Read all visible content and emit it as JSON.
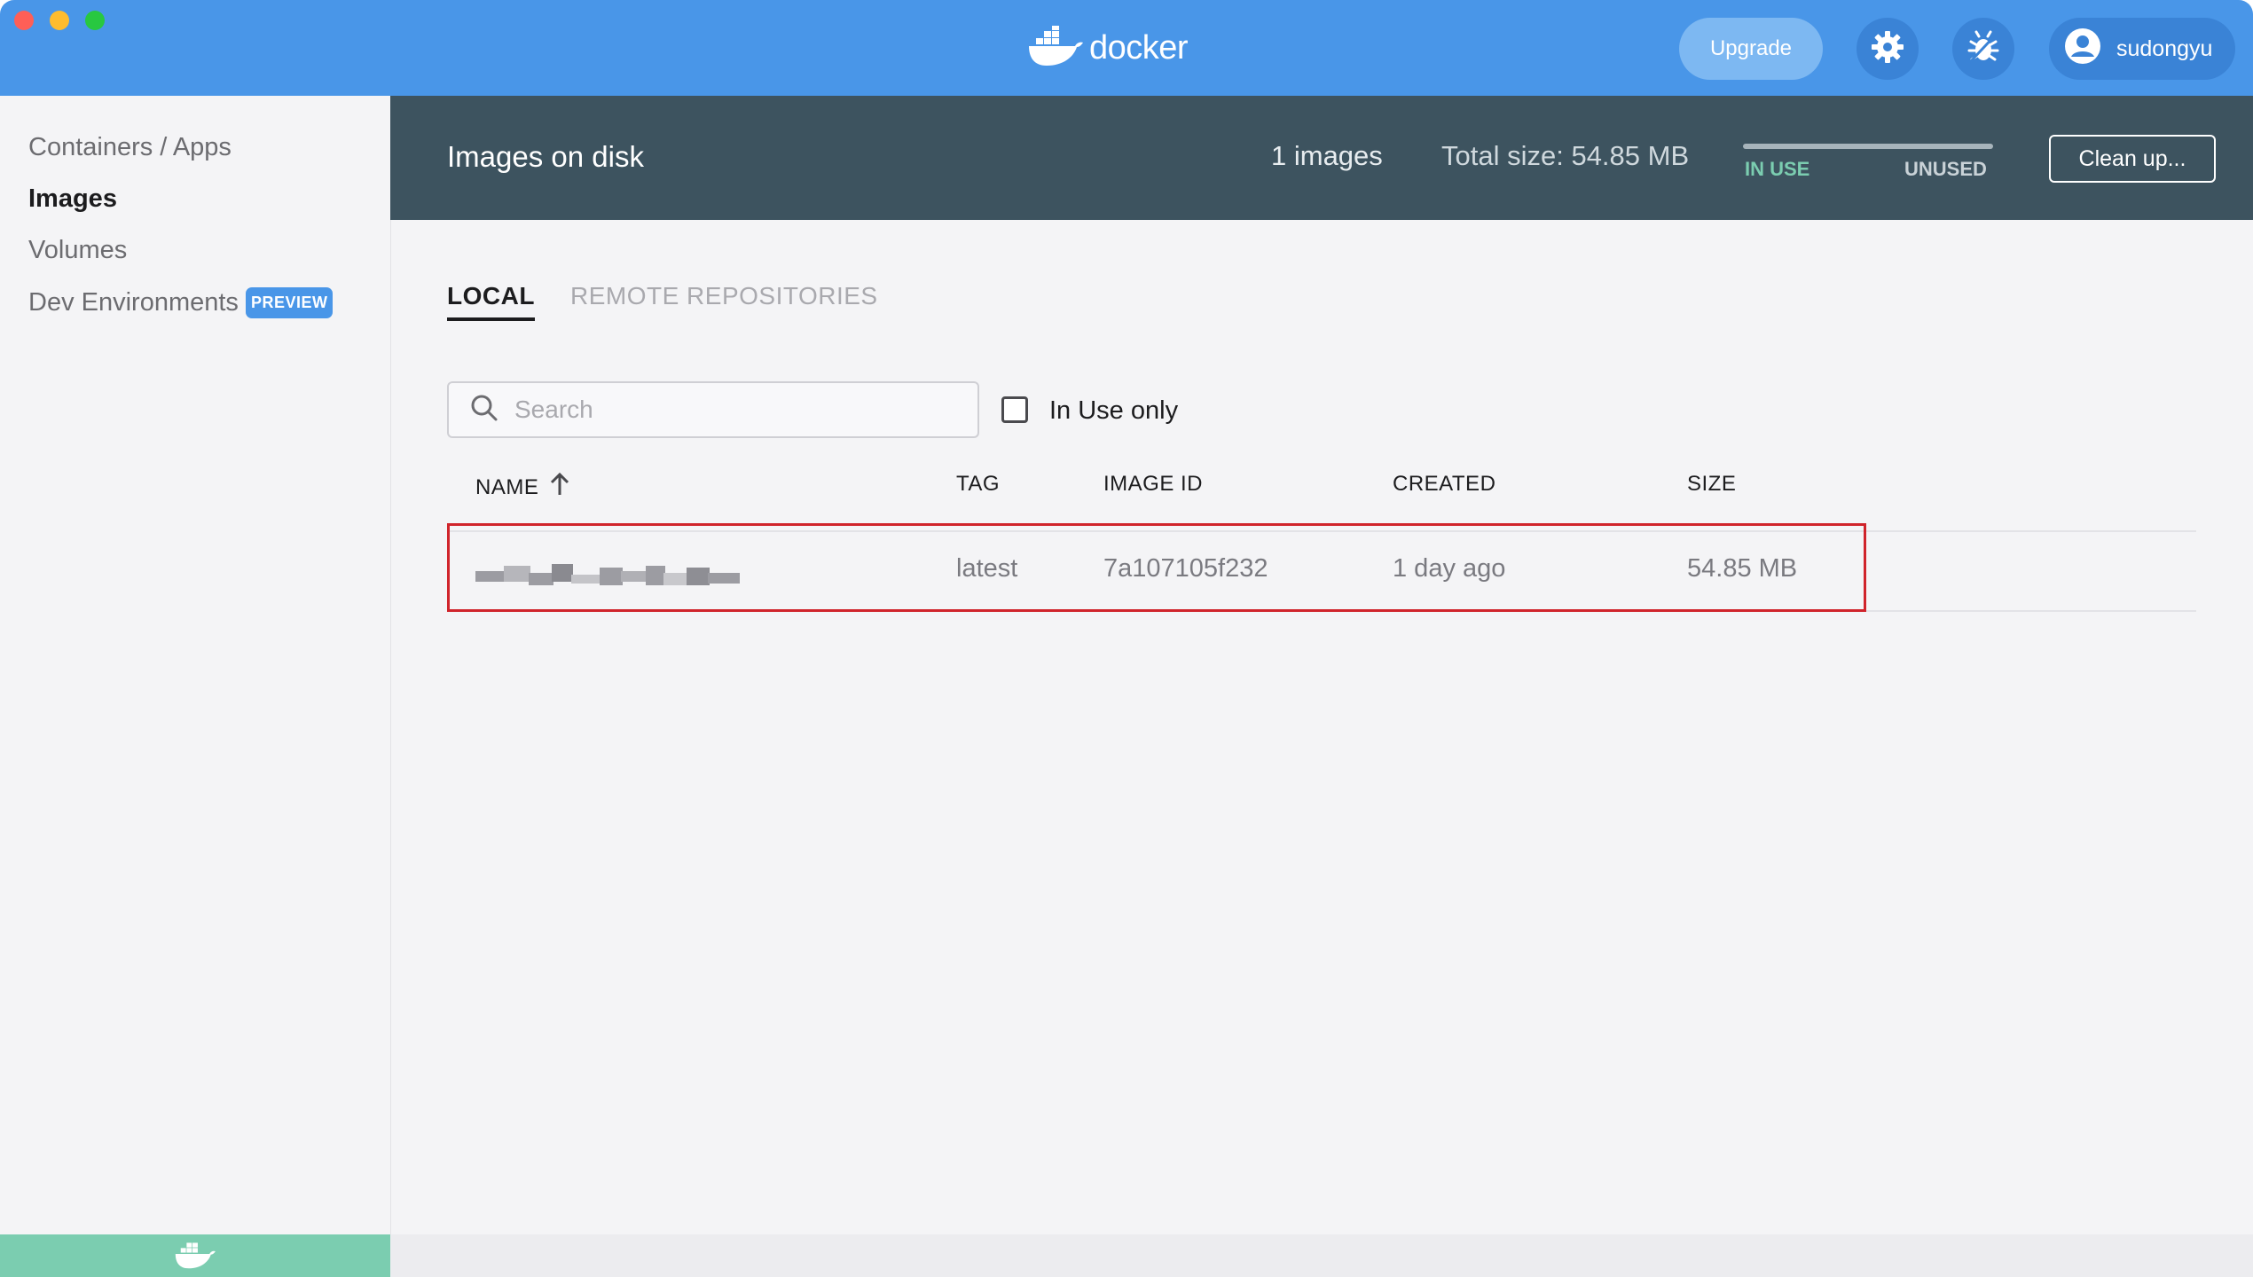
{
  "app": {
    "brand": "docker",
    "upgrade_label": "Upgrade",
    "username": "sudongyu",
    "colors": {
      "titlebar": "#4996e8",
      "header_band": "#3d535f",
      "accent_green": "#7bcdb0",
      "highlight_border": "#d0242b"
    }
  },
  "sidebar": {
    "items": [
      {
        "label": "Containers / Apps",
        "active": false
      },
      {
        "label": "Images",
        "active": true
      },
      {
        "label": "Volumes",
        "active": false
      },
      {
        "label": "Dev Environments",
        "badge": "PREVIEW",
        "active": false
      }
    ]
  },
  "header": {
    "title": "Images on disk",
    "image_count": "1 images",
    "total_size": "Total size: 54.85 MB",
    "in_use_label": "IN USE",
    "unused_label": "UNUSED",
    "in_use_fraction": 0,
    "cleanup_label": "Clean up..."
  },
  "tabs": [
    {
      "label": "LOCAL",
      "active": true
    },
    {
      "label": "REMOTE REPOSITORIES",
      "active": false
    }
  ],
  "filters": {
    "search_placeholder": "Search",
    "in_use_only_label": "In Use only",
    "in_use_only_checked": false
  },
  "table": {
    "columns": [
      "NAME",
      "TAG",
      "IMAGE ID",
      "CREATED",
      "SIZE"
    ],
    "sort": {
      "column": "NAME",
      "direction": "ascending"
    },
    "rows": [
      {
        "name": "",
        "name_obscured": true,
        "tag": "latest",
        "image_id": "7a107105f232",
        "created": "1 day ago",
        "size": "54.85 MB"
      }
    ]
  }
}
